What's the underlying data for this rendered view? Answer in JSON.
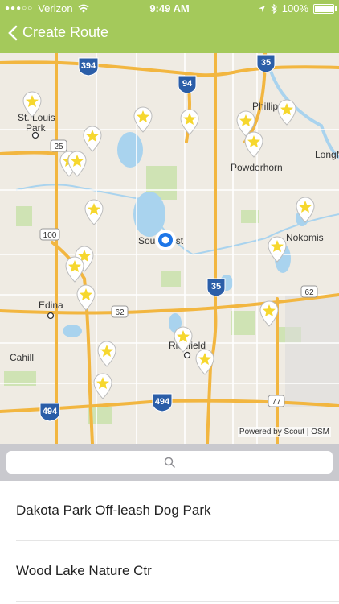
{
  "status": {
    "carrier": "Verizon",
    "time": "9:49 AM",
    "battery": "100%"
  },
  "nav": {
    "back_label": "Create Route"
  },
  "map": {
    "labels": {
      "st_louis_park_1": "St. Louis",
      "st_louis_park_2": "Park",
      "edina": "Edina",
      "cahill": "Cahill",
      "southwest": "Southwest",
      "richfield": "Richfield",
      "nokomis": "Nokomis",
      "powderhorn": "Powderhorn",
      "phillips": "Phillips",
      "longfellow": "Longfe"
    },
    "route_labels": {
      "i394": "394",
      "i94": "94",
      "i35_top": "35",
      "i35_mid": "35",
      "i494_left": "494",
      "i494_mid": "494",
      "hw25": "25",
      "hw100": "100",
      "hw62_mid": "62",
      "hw62_right": "62",
      "hw77": "77"
    },
    "attribution": "Powered by Scout | OSM",
    "colors": {
      "background": "#efebe3",
      "highway": "#f2b640",
      "interstate_shield": "#2b5ea8",
      "water": "#a9d3ee",
      "park": "#cfe3b4",
      "pin_star": "#f6d72e",
      "location_dot": "#1d76e8"
    }
  },
  "search": {
    "icon": "search-icon",
    "placeholder": ""
  },
  "list": {
    "items": [
      {
        "label": "Dakota Park Off-leash Dog Park"
      },
      {
        "label": "Wood Lake Nature Ctr"
      }
    ]
  }
}
